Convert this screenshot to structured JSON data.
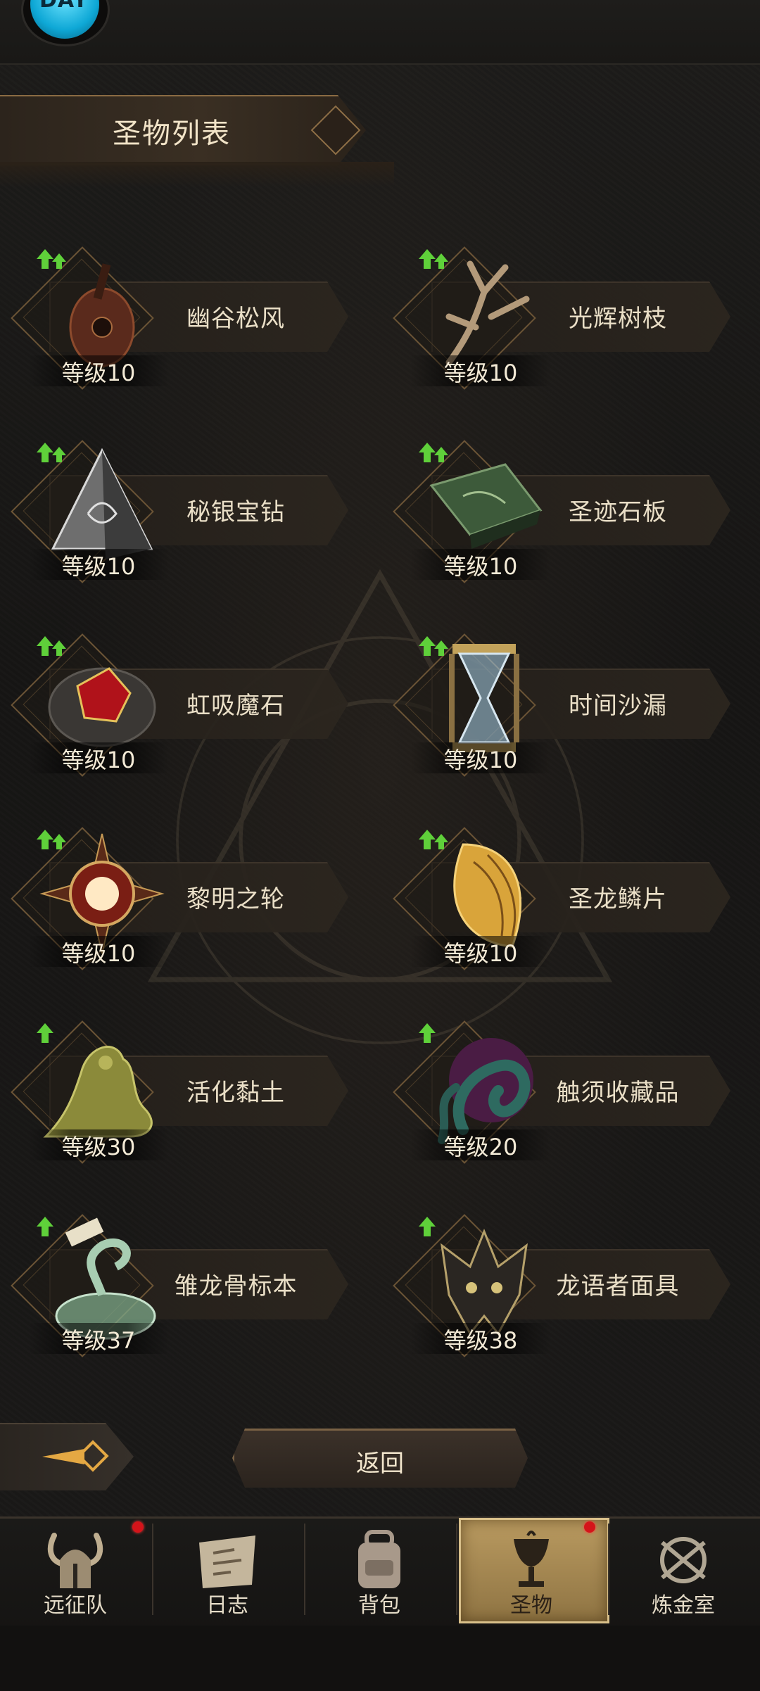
{
  "app": {
    "logo_text": "DAY"
  },
  "header": {
    "title": "圣物列表"
  },
  "relics": [
    {
      "name": "幽谷松风",
      "level": "等级10",
      "icon": "lute-icon",
      "upgrade": true
    },
    {
      "name": "光辉树枝",
      "level": "等级10",
      "icon": "branch-icon",
      "upgrade": true
    },
    {
      "name": "秘银宝钻",
      "level": "等级10",
      "icon": "pyramid-gem-icon",
      "upgrade": true
    },
    {
      "name": "圣迹石板",
      "level": "等级10",
      "icon": "stone-slab-icon",
      "upgrade": true
    },
    {
      "name": "虹吸魔石",
      "level": "等级10",
      "icon": "red-magic-stone-icon",
      "upgrade": true
    },
    {
      "name": "时间沙漏",
      "level": "等级10",
      "icon": "hourglass-icon",
      "upgrade": true
    },
    {
      "name": "黎明之轮",
      "level": "等级10",
      "icon": "sun-wheel-icon",
      "upgrade": true
    },
    {
      "name": "圣龙鳞片",
      "level": "等级10",
      "icon": "dragon-scale-icon",
      "upgrade": true
    },
    {
      "name": "活化黏土",
      "level": "等级30",
      "icon": "clay-icon",
      "upgrade": true
    },
    {
      "name": "触须收藏品",
      "level": "等级20",
      "icon": "tentacle-icon",
      "upgrade": true
    },
    {
      "name": "雏龙骨标本",
      "level": "等级37",
      "icon": "specimen-jar-icon",
      "upgrade": true
    },
    {
      "name": "龙语者面具",
      "level": "等级38",
      "icon": "dragon-mask-icon",
      "upgrade": true
    }
  ],
  "actions": {
    "back_label": "返回"
  },
  "nav": [
    {
      "label": "远征队",
      "icon": "horned-helmet-icon",
      "badge": true,
      "active": false
    },
    {
      "label": "日志",
      "icon": "scroll-map-icon",
      "badge": false,
      "active": false
    },
    {
      "label": "背包",
      "icon": "backpack-icon",
      "badge": false,
      "active": false
    },
    {
      "label": "圣物",
      "icon": "chalice-icon",
      "badge": true,
      "active": true
    },
    {
      "label": "炼金室",
      "icon": "alchemy-icon",
      "badge": false,
      "active": false
    }
  ],
  "colors": {
    "upgrade_green": "#5fd03a",
    "badge_red": "#d4141a",
    "active_tab": "#b99a60",
    "gold_border": "#8a6b43"
  }
}
